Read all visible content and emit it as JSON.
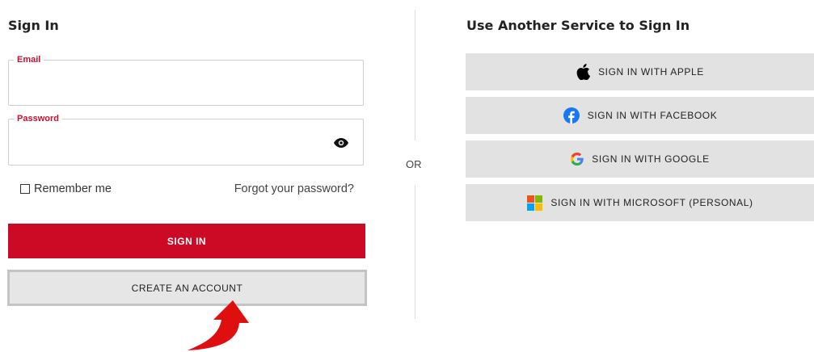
{
  "signin": {
    "heading": "Sign In",
    "email_label": "Email",
    "email_value": "",
    "password_label": "Password",
    "password_value": "",
    "remember_label": "Remember me",
    "forgot_label": "Forgot your password?",
    "signin_button": "SIGN IN",
    "create_button": "CREATE AN ACCOUNT"
  },
  "divider": {
    "label": "OR"
  },
  "services": {
    "heading": "Use Another Service to Sign In",
    "apple": "SIGN IN WITH APPLE",
    "facebook": "SIGN IN WITH FACEBOOK",
    "google": "SIGN IN WITH GOOGLE",
    "microsoft": "SIGN IN WITH MICROSOFT (PERSONAL)"
  },
  "colors": {
    "accent": "#cc0a26",
    "facebook": "#1877f2",
    "microsoft": [
      "#f25022",
      "#7fba00",
      "#00a4ef",
      "#ffb900"
    ]
  },
  "icons": [
    "eye-icon",
    "apple-icon",
    "facebook-icon",
    "google-icon",
    "microsoft-icon",
    "curved-arrow-icon"
  ]
}
